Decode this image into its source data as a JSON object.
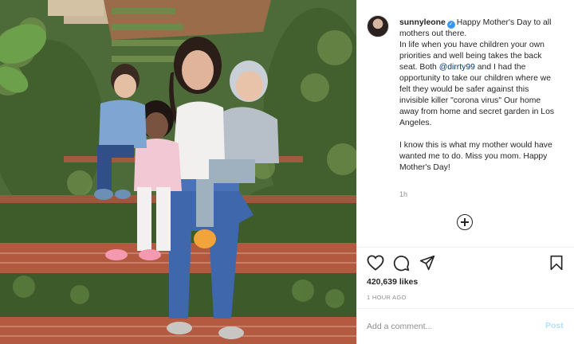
{
  "post": {
    "username": "sunnyleone",
    "verified_icon": "verified-badge-icon",
    "caption_first": "Happy Mother's Day to all mothers out there.",
    "caption_part1": "In life when you have children your own priorities and well being takes the back seat. Both ",
    "mention": "@dirrty99",
    "caption_part2": " and I had the opportunity to take our children where we felt they would be safer against this invisible killer \"corona virus\" Our home away from home and secret garden in Los Angeles.",
    "caption_second": "I know this is what my mother would have wanted me to do. Miss you mom. Happy Mother's Day!",
    "comment_time": "1h",
    "likes": "420,639 likes",
    "posted_ago": "1 HOUR AGO"
  },
  "actions": {
    "like_icon": "heart-icon",
    "comment_icon": "comment-icon",
    "share_icon": "share-icon",
    "save_icon": "bookmark-icon",
    "add_icon": "plus-circle-icon"
  },
  "comment_box": {
    "placeholder": "Add a comment...",
    "post_label": "Post"
  },
  "colors": {
    "link": "#00376b",
    "verified": "#3897f0",
    "post_disabled": "#b2dffc",
    "muted": "#8e8e8e"
  }
}
